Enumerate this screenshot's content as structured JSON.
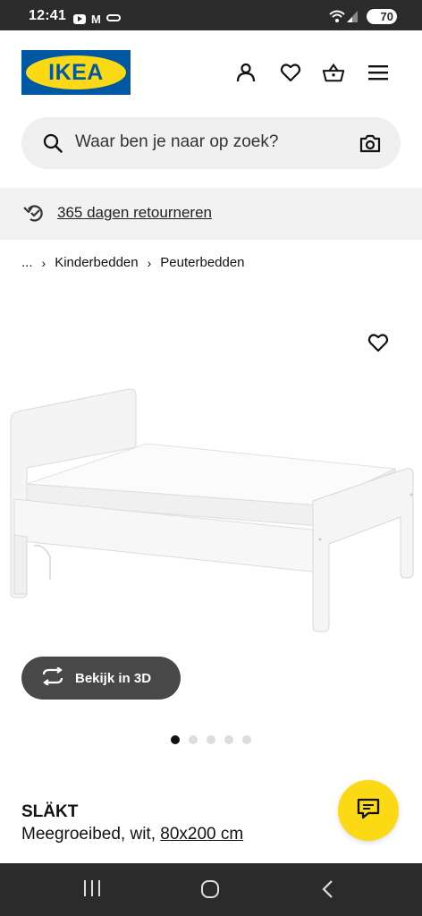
{
  "status_bar": {
    "time": "12:41",
    "gmail_glyph": "M",
    "battery": "70",
    "icons": [
      "youtube-icon",
      "gmail-icon",
      "link-icon",
      "wifi-icon",
      "signal-icon"
    ]
  },
  "header": {
    "logo_text": "IKEA",
    "icons": [
      "person-icon",
      "heart-icon",
      "basket-icon",
      "menu-icon"
    ],
    "colors": {
      "logo_blue": "#0058a3",
      "logo_yellow": "#fbd914"
    }
  },
  "search": {
    "placeholder": "Waar ben je naar op zoek?"
  },
  "returns_banner": {
    "text": "365 dagen retourneren"
  },
  "breadcrumb": {
    "items": [
      "...",
      "Kinderbedden",
      "Peuterbedden"
    ]
  },
  "gallery": {
    "view_3d_label": "Bekijk in 3D",
    "image_count": 5,
    "active_index": 0
  },
  "product": {
    "name": "SLÄKT",
    "description": "Meegroeibed, wit,",
    "size": "80x200 cm"
  },
  "chat": {
    "color": "#fbd914"
  },
  "nav_bar": {
    "icons": [
      "recents-icon",
      "home-icon",
      "back-icon"
    ]
  }
}
